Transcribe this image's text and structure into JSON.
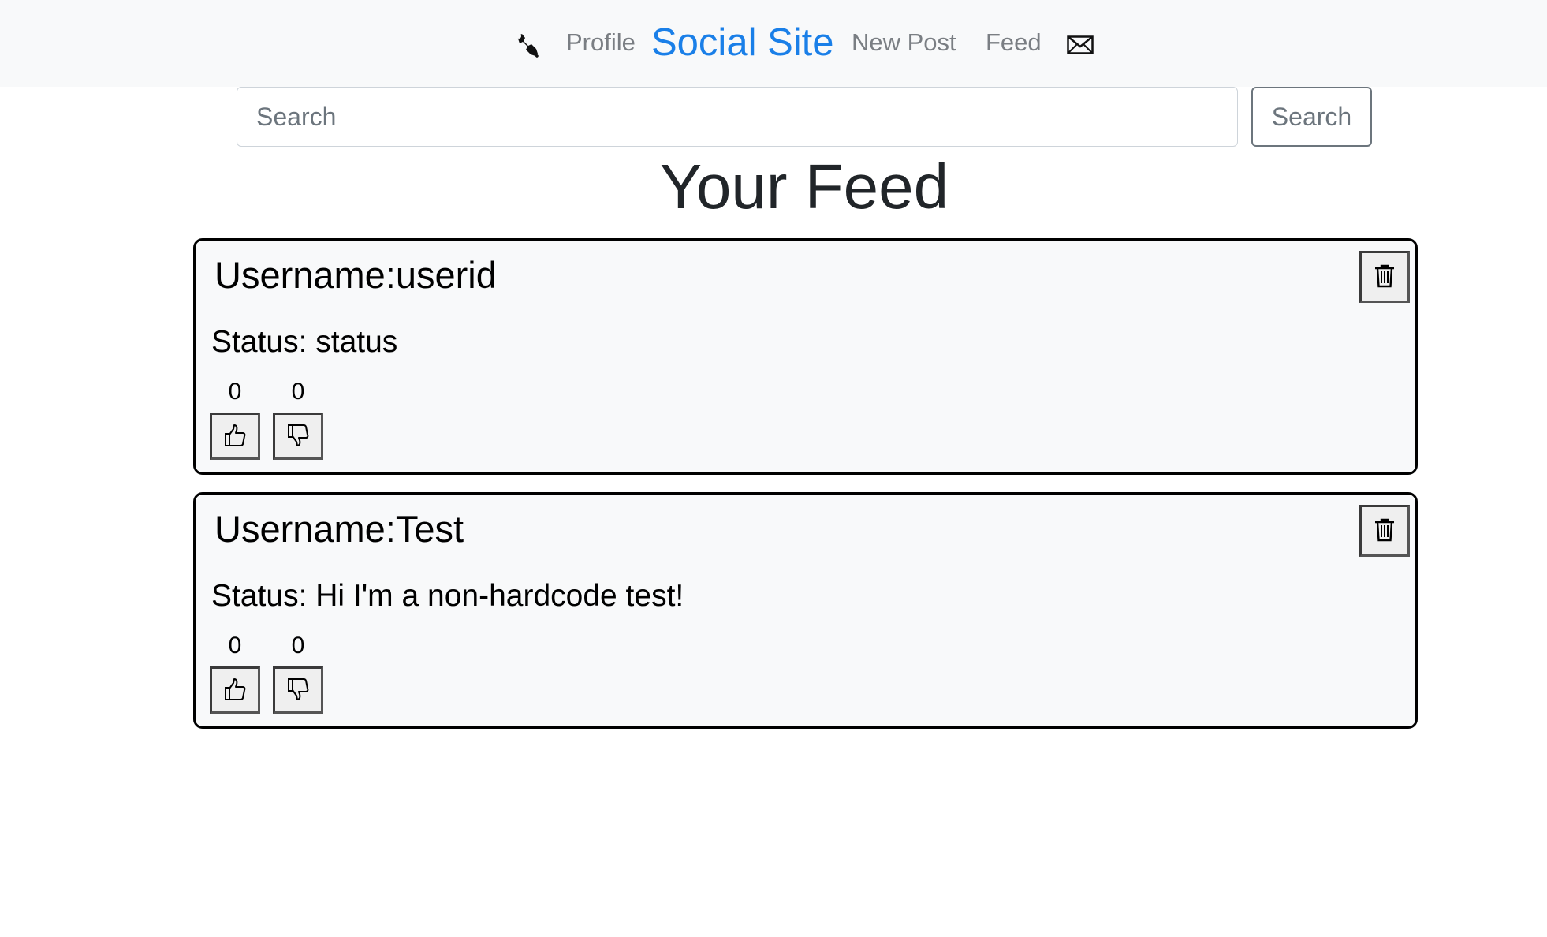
{
  "navbar": {
    "settings_icon": "wrench-icon",
    "profile_label": "Profile",
    "brand_label": "Social Site",
    "new_post_label": "New Post",
    "feed_label": "Feed",
    "messages_icon": "envelope-icon",
    "brand_color": "#1a7fe8"
  },
  "search": {
    "placeholder": "Search",
    "value": "",
    "button_label": "Search"
  },
  "page": {
    "title": "Your Feed"
  },
  "posts": [
    {
      "username": "Username:userid",
      "status": "Status: status",
      "likes": "0",
      "dislikes": "0"
    },
    {
      "username": "Username:Test",
      "status": "Status: Hi I'm a non-hardcode test!",
      "likes": "0",
      "dislikes": "0"
    }
  ]
}
